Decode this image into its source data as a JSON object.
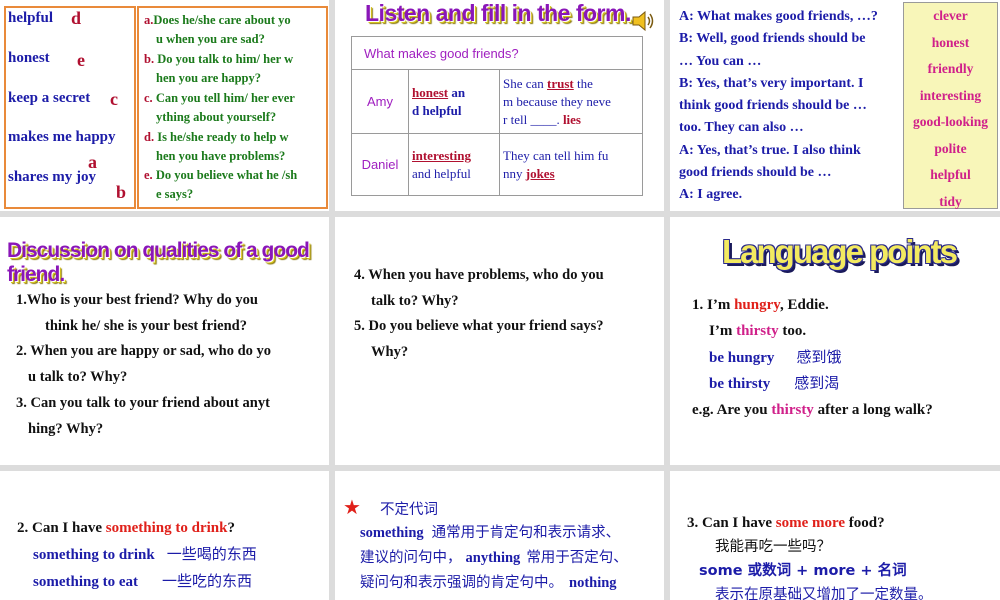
{
  "slide1": {
    "qualities": [
      {
        "word": "helpful",
        "letter": "d"
      },
      {
        "word": "honest",
        "letter": "e"
      },
      {
        "word": "keep a secret",
        "letter": "c"
      },
      {
        "word": "makes me happy",
        "letter": "a"
      },
      {
        "word": "shares my joy",
        "letter": "b"
      }
    ],
    "options": [
      {
        "key": "a.",
        "line1": "Does he/she care about yo",
        "line2": "u when you are sad?"
      },
      {
        "key": "b.",
        "line1": "Do you talk to him/ her w",
        "line2": "hen you are happy?"
      },
      {
        "key": "c.",
        "line1": "Can you tell him/ her ever",
        "line2": "ything about yourself?"
      },
      {
        "key": "d.",
        "line1": "Is he/she ready to help  w",
        "line2": "hen you have problems?"
      },
      {
        "key": "e.",
        "line1": "Do you believe what he /sh",
        "line2": "e says?"
      }
    ]
  },
  "slide2": {
    "title": "Listen and fill in the form.",
    "header": "What makes good friends?",
    "rows": [
      {
        "name": "Amy",
        "answer1": "honest",
        "col1_rest_a": "an",
        "col1_rest_b": "d helpful",
        "col2_a": "She can",
        "answer2": "trust",
        "col2_b": "the",
        "col2_c": "m because they neve",
        "col2_d": "r tell",
        "answer3": "lies"
      },
      {
        "name": "Daniel",
        "answer1": "interesting",
        "col1_rest_b": "and helpful",
        "col2_a": "They can tell him fu",
        "col2_c": "nny",
        "answer2": "jokes"
      }
    ]
  },
  "slide3": {
    "dialogue": [
      "A: What makes good friends, …?",
      "B: Well, good friends should be",
      "… You can …",
      "B: Yes, that’s very important. I",
      "think good friends should be …",
      "too. They can also …",
      "A: Yes, that’s true. I also think",
      "good friends should be …",
      "A: I agree."
    ],
    "words": [
      "clever",
      "honest",
      "friendly",
      "interesting",
      "good-looking",
      "polite",
      "helpful",
      "tidy"
    ]
  },
  "slide4": {
    "title": "Discussion on qualities of a good friend.",
    "lines": [
      "1.Who is your best friend? Why do you",
      "think he/ she is your best friend?",
      "2. When you are happy or sad, who do yo",
      "u talk to? Why?",
      "3. Can you talk to your friend about anyt",
      "hing? Why?"
    ]
  },
  "slide5": {
    "lines": [
      "4. When you have problems, who do you",
      "talk to? Why?",
      "5. Do you believe what your friend says?",
      "Why?"
    ]
  },
  "slide6": {
    "title": "Language points",
    "l1_a": "1. I’m ",
    "l1_b": "hungry",
    "l1_c": ", Eddie.",
    "l2_a": "I’m ",
    "l2_b": "thirsty",
    "l2_c": " too.",
    "l3_a": "be hungry",
    "l3_b": "感到饿",
    "l4_a": "be thirsty",
    "l4_b": "感到渴",
    "l5_a": "e.g. Are you ",
    "l5_b": "thirsty",
    "l5_c": " after a long walk?"
  },
  "slide7": {
    "l1_a": "2. Can I have ",
    "l1_b": "something to drink",
    "l1_c": "?",
    "l2_a": "something to drink",
    "l2_b": "一些喝的东西",
    "l3_a": "something to eat",
    "l3_b": "一些吃的东西"
  },
  "slide8": {
    "heading": "不定代词",
    "l1_a": "something",
    "l1_b": "通常用于肯定句和表示请求、",
    "l2": "建议的问句中，",
    "l2_b": "anything",
    "l2_c": "常用于否定句、",
    "l3_a": "疑问句和表示强调的肯定句中。",
    "l3_b": "nothing"
  },
  "slide9": {
    "l1_a": "3. Can I have ",
    "l1_b": "some more",
    "l1_c": " food?",
    "l2": "我能再吃一些吗？",
    "l3": "some  或数词    + more +  名词",
    "l4": "表示在原基础又增加了一定数量。"
  },
  "colors": {
    "orange_border": "#e98a3a",
    "blue": "#1c1ca8",
    "green": "#1b7a1b",
    "red": "#e0201a",
    "maroon": "#b01030",
    "magenta": "#d0208a",
    "word_bg": "#f8f6b9"
  }
}
